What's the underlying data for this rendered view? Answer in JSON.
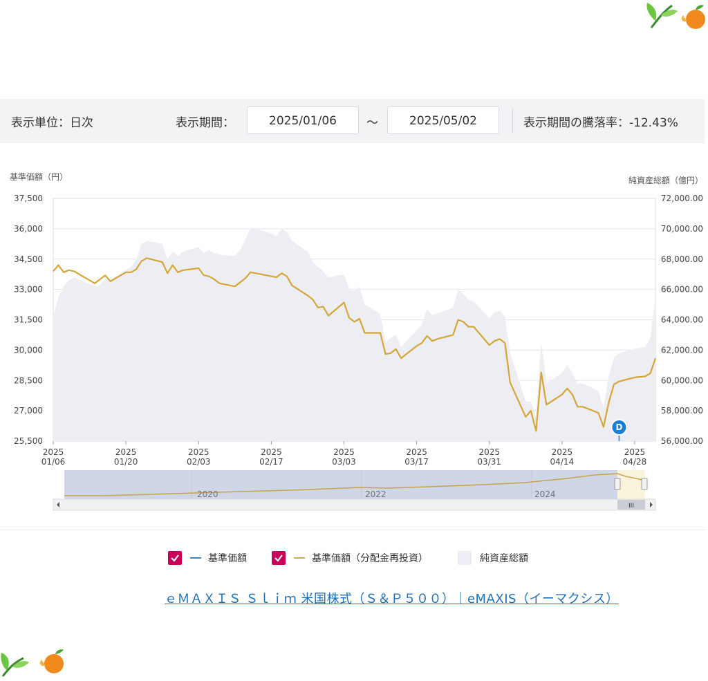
{
  "controls": {
    "unit_label": "表示単位：日次",
    "period_label": "表示期間：",
    "start_date": "2025/01/06",
    "tilde": "～",
    "end_date": "2025/05/02",
    "change_label": "表示期間の騰落率：-12.43%"
  },
  "legend": {
    "items": [
      {
        "label": "基準価額",
        "checked": true,
        "color": "#2e8bd1"
      },
      {
        "label": "基準価額（分配金再投資）",
        "checked": true,
        "color": "#d4a636"
      },
      {
        "label": "純資産総額",
        "color": "#eceef3"
      }
    ]
  },
  "source_link": "ｅＭＡＸＩＳ Ｓｌｉｍ 米国株式（Ｓ＆Ｐ５００）｜eMAXIS（イーマクシス）",
  "colors": {
    "price_line": "#d4a636",
    "area_fill": "#eceef3",
    "marker": "#1a7fd4",
    "checkbox": "#c8005a"
  },
  "chart_data": {
    "type": "line",
    "y_left_label": "基準価額（円）",
    "y_right_label": "純資産総額（億円）",
    "y_left_ticks": [
      "37,500",
      "36,000",
      "34,500",
      "33,000",
      "31,500",
      "30,000",
      "28,500",
      "27,000",
      "25,500"
    ],
    "y_left_range": [
      25500,
      37500
    ],
    "y_right_ticks": [
      "72,000.00",
      "70,000.00",
      "68,000.00",
      "66,000.00",
      "64,000.00",
      "62,000.00",
      "60,000.00",
      "58,000.00",
      "56,000.00"
    ],
    "y_right_range": [
      56000,
      72000
    ],
    "x_ticks": [
      {
        "date": "2025-01-06",
        "year": "2025",
        "md": "01/06"
      },
      {
        "date": "2025-01-20",
        "year": "2025",
        "md": "01/20"
      },
      {
        "date": "2025-02-03",
        "year": "2025",
        "md": "02/03"
      },
      {
        "date": "2025-02-17",
        "year": "2025",
        "md": "02/17"
      },
      {
        "date": "2025-03-03",
        "year": "2025",
        "md": "03/03"
      },
      {
        "date": "2025-03-17",
        "year": "2025",
        "md": "03/17"
      },
      {
        "date": "2025-03-31",
        "year": "2025",
        "md": "03/31"
      },
      {
        "date": "2025-04-14",
        "year": "2025",
        "md": "04/14"
      },
      {
        "date": "2025-04-28",
        "year": "2025",
        "md": "04/28"
      }
    ],
    "x_range": [
      "2025-01-06",
      "2025-05-02"
    ],
    "series": [
      {
        "name": "基準価額（分配金再投資）",
        "axis": "left",
        "points": [
          [
            "2025-01-06",
            33900
          ],
          [
            "2025-01-07",
            34200
          ],
          [
            "2025-01-08",
            33850
          ],
          [
            "2025-01-09",
            33950
          ],
          [
            "2025-01-10",
            33900
          ],
          [
            "2025-01-14",
            33300
          ],
          [
            "2025-01-15",
            33500
          ],
          [
            "2025-01-16",
            33700
          ],
          [
            "2025-01-17",
            33400
          ],
          [
            "2025-01-20",
            33850
          ],
          [
            "2025-01-21",
            33850
          ],
          [
            "2025-01-22",
            34000
          ],
          [
            "2025-01-23",
            34400
          ],
          [
            "2025-01-24",
            34550
          ],
          [
            "2025-01-27",
            34350
          ],
          [
            "2025-01-28",
            33800
          ],
          [
            "2025-01-29",
            34200
          ],
          [
            "2025-01-30",
            33850
          ],
          [
            "2025-01-31",
            33950
          ],
          [
            "2025-02-03",
            34050
          ],
          [
            "2025-02-04",
            33700
          ],
          [
            "2025-02-05",
            33650
          ],
          [
            "2025-02-06",
            33500
          ],
          [
            "2025-02-07",
            33300
          ],
          [
            "2025-02-10",
            33150
          ],
          [
            "2025-02-11",
            33350
          ],
          [
            "2025-02-12",
            33550
          ],
          [
            "2025-02-13",
            33850
          ],
          [
            "2025-02-14",
            33800
          ],
          [
            "2025-02-17",
            33650
          ],
          [
            "2025-02-18",
            33600
          ],
          [
            "2025-02-19",
            33800
          ],
          [
            "2025-02-20",
            33650
          ],
          [
            "2025-02-21",
            33200
          ],
          [
            "2025-02-24",
            32700
          ],
          [
            "2025-02-25",
            32500
          ],
          [
            "2025-02-26",
            32100
          ],
          [
            "2025-02-27",
            32150
          ],
          [
            "2025-02-28",
            31700
          ],
          [
            "2025-03-03",
            32350
          ],
          [
            "2025-03-04",
            31600
          ],
          [
            "2025-03-05",
            31400
          ],
          [
            "2025-03-06",
            31550
          ],
          [
            "2025-03-07",
            30850
          ],
          [
            "2025-03-10",
            30850
          ],
          [
            "2025-03-11",
            29800
          ],
          [
            "2025-03-12",
            29850
          ],
          [
            "2025-03-13",
            30050
          ],
          [
            "2025-03-14",
            29600
          ],
          [
            "2025-03-17",
            30200
          ],
          [
            "2025-03-18",
            30350
          ],
          [
            "2025-03-19",
            30700
          ],
          [
            "2025-03-20",
            30450
          ],
          [
            "2025-03-21",
            30550
          ],
          [
            "2025-03-24",
            30750
          ],
          [
            "2025-03-25",
            31500
          ],
          [
            "2025-03-26",
            31400
          ],
          [
            "2025-03-27",
            31150
          ],
          [
            "2025-03-28",
            31150
          ],
          [
            "2025-03-31",
            30250
          ],
          [
            "2025-04-01",
            30450
          ],
          [
            "2025-04-02",
            30550
          ],
          [
            "2025-04-03",
            30350
          ],
          [
            "2025-04-04",
            28400
          ],
          [
            "2025-04-07",
            26700
          ],
          [
            "2025-04-08",
            27000
          ],
          [
            "2025-04-09",
            26000
          ],
          [
            "2025-04-10",
            28900
          ],
          [
            "2025-04-11",
            27300
          ],
          [
            "2025-04-14",
            27800
          ],
          [
            "2025-04-15",
            28100
          ],
          [
            "2025-04-16",
            27800
          ],
          [
            "2025-04-17",
            27200
          ],
          [
            "2025-04-18",
            27200
          ],
          [
            "2025-04-21",
            26900
          ],
          [
            "2025-04-22",
            26200
          ],
          [
            "2025-04-23",
            27400
          ],
          [
            "2025-04-24",
            28300
          ],
          [
            "2025-04-25",
            28450
          ],
          [
            "2025-04-28",
            28650
          ],
          [
            "2025-04-30",
            28700
          ],
          [
            "2025-05-01",
            28850
          ],
          [
            "2025-05-02",
            29600
          ]
        ]
      },
      {
        "name": "純資産総額",
        "axis": "right",
        "points": [
          [
            "2025-01-06",
            64200
          ],
          [
            "2025-01-07",
            65500
          ],
          [
            "2025-01-08",
            66200
          ],
          [
            "2025-01-09",
            66600
          ],
          [
            "2025-01-10",
            66800
          ],
          [
            "2025-01-14",
            66200
          ],
          [
            "2025-01-15",
            66300
          ],
          [
            "2025-01-16",
            66700
          ],
          [
            "2025-01-17",
            66600
          ],
          [
            "2025-01-20",
            67300
          ],
          [
            "2025-01-21",
            67500
          ],
          [
            "2025-01-22",
            68000
          ],
          [
            "2025-01-23",
            69000
          ],
          [
            "2025-01-24",
            69200
          ],
          [
            "2025-01-27",
            69000
          ],
          [
            "2025-01-28",
            68000
          ],
          [
            "2025-01-29",
            68500
          ],
          [
            "2025-01-30",
            68200
          ],
          [
            "2025-01-31",
            68500
          ],
          [
            "2025-02-03",
            68800
          ],
          [
            "2025-02-04",
            68400
          ],
          [
            "2025-02-05",
            68600
          ],
          [
            "2025-02-06",
            68400
          ],
          [
            "2025-02-07",
            68300
          ],
          [
            "2025-02-10",
            68200
          ],
          [
            "2025-02-11",
            68600
          ],
          [
            "2025-02-12",
            69300
          ],
          [
            "2025-02-13",
            70000
          ],
          [
            "2025-02-14",
            70000
          ],
          [
            "2025-02-17",
            69700
          ],
          [
            "2025-02-18",
            69500
          ],
          [
            "2025-02-19",
            70000
          ],
          [
            "2025-02-20",
            69800
          ],
          [
            "2025-02-21",
            69200
          ],
          [
            "2025-02-24",
            68500
          ],
          [
            "2025-02-25",
            67800
          ],
          [
            "2025-02-26",
            67500
          ],
          [
            "2025-02-27",
            67200
          ],
          [
            "2025-02-28",
            66800
          ],
          [
            "2025-03-03",
            67000
          ],
          [
            "2025-03-04",
            66000
          ],
          [
            "2025-03-05",
            65900
          ],
          [
            "2025-03-06",
            66200
          ],
          [
            "2025-03-07",
            65000
          ],
          [
            "2025-03-10",
            64400
          ],
          [
            "2025-03-11",
            62500
          ],
          [
            "2025-03-12",
            62800
          ],
          [
            "2025-03-13",
            63000
          ],
          [
            "2025-03-14",
            62200
          ],
          [
            "2025-03-17",
            63300
          ],
          [
            "2025-03-18",
            63700
          ],
          [
            "2025-03-19",
            64700
          ],
          [
            "2025-03-20",
            64300
          ],
          [
            "2025-03-21",
            64400
          ],
          [
            "2025-03-24",
            64800
          ],
          [
            "2025-03-25",
            66000
          ],
          [
            "2025-03-26",
            65700
          ],
          [
            "2025-03-27",
            65300
          ],
          [
            "2025-03-28",
            65200
          ],
          [
            "2025-03-31",
            64100
          ],
          [
            "2025-04-01",
            64500
          ],
          [
            "2025-04-02",
            64600
          ],
          [
            "2025-04-03",
            64200
          ],
          [
            "2025-04-04",
            61800
          ],
          [
            "2025-04-07",
            58600
          ],
          [
            "2025-04-08",
            58600
          ],
          [
            "2025-04-09",
            57600
          ],
          [
            "2025-04-10",
            62500
          ],
          [
            "2025-04-11",
            59800
          ],
          [
            "2025-04-14",
            60500
          ],
          [
            "2025-04-15",
            61000
          ],
          [
            "2025-04-16",
            60500
          ],
          [
            "2025-04-17",
            59800
          ],
          [
            "2025-04-18",
            59800
          ],
          [
            "2025-04-21",
            59300
          ],
          [
            "2025-04-22",
            58200
          ],
          [
            "2025-04-23",
            60300
          ],
          [
            "2025-04-24",
            61500
          ],
          [
            "2025-04-25",
            61800
          ],
          [
            "2025-04-28",
            62100
          ],
          [
            "2025-04-30",
            62200
          ],
          [
            "2025-05-01",
            62800
          ],
          [
            "2025-05-02",
            65500
          ]
        ]
      }
    ],
    "navigator": {
      "year_labels": [
        "2020",
        "2022",
        "2024"
      ],
      "scrollbar_grip": "III"
    },
    "marker": {
      "label": "D",
      "date": "2025-04-25"
    },
    "grid": true
  }
}
